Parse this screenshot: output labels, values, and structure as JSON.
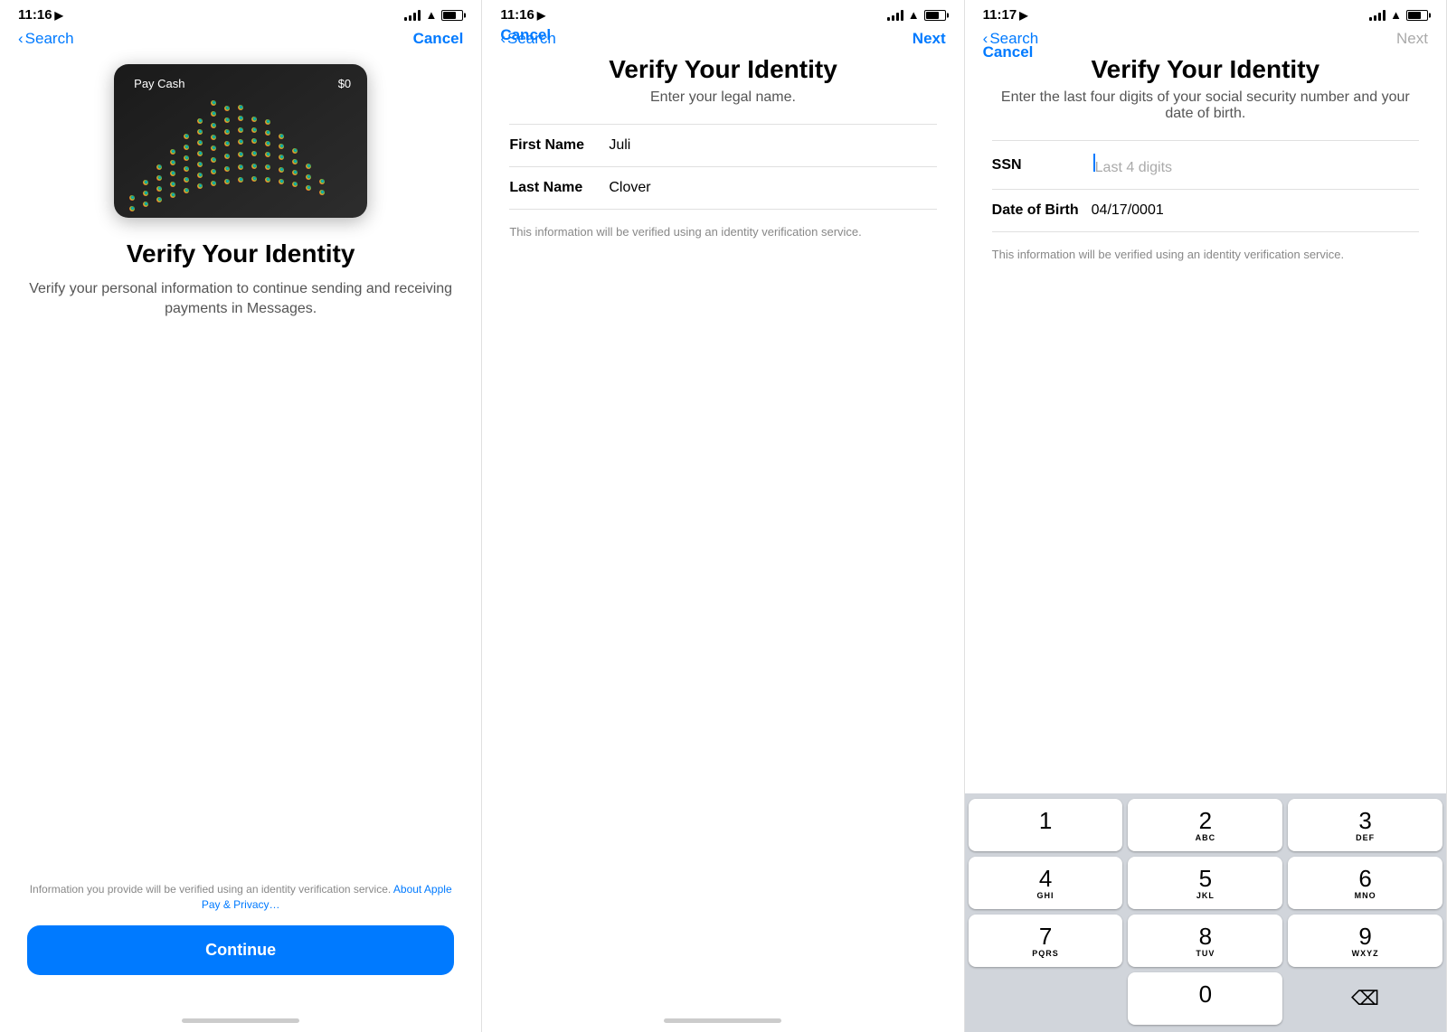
{
  "screens": [
    {
      "id": "screen1",
      "status": {
        "time": "11:16",
        "hasLocation": true
      },
      "nav": {
        "back_label": "Search",
        "cancel_label": "Cancel"
      },
      "card": {
        "brand": "Pay Cash",
        "balance": "$0"
      },
      "title": "Verify Your Identity",
      "subtitle": "Verify your personal information to continue sending and receiving payments in Messages.",
      "footer": {
        "privacy_text": "Information you provide will be verified using an identity verification service.",
        "privacy_link": "About Apple Pay & Privacy…",
        "continue_label": "Continue"
      }
    },
    {
      "id": "screen2",
      "status": {
        "time": "11:16",
        "hasLocation": true
      },
      "nav": {
        "back_label": "Search",
        "cancel_label": "Cancel",
        "next_label": "Next",
        "next_active": true
      },
      "title": "Verify Your Identity",
      "subtitle": "Enter your legal name.",
      "form": {
        "first_name_label": "First Name",
        "first_name_value": "Juli",
        "last_name_label": "Last Name",
        "last_name_value": "Clover",
        "note": "This information will be verified using an identity verification service."
      }
    },
    {
      "id": "screen3",
      "status": {
        "time": "11:17",
        "hasLocation": true
      },
      "nav": {
        "back_label": "Search",
        "cancel_label": "Cancel",
        "next_label": "Next",
        "next_active": false
      },
      "title": "Verify Your Identity",
      "subtitle": "Enter the last four digits of your social security number and your date of birth.",
      "form": {
        "ssn_label": "SSN",
        "ssn_placeholder": "Last 4 digits",
        "dob_label": "Date of Birth",
        "dob_value": "04/17/0001",
        "note": "This information will be verified using an identity verification service."
      },
      "keypad": {
        "keys": [
          {
            "number": "1",
            "letters": ""
          },
          {
            "number": "2",
            "letters": "ABC"
          },
          {
            "number": "3",
            "letters": "DEF"
          },
          {
            "number": "4",
            "letters": "GHI"
          },
          {
            "number": "5",
            "letters": "JKL"
          },
          {
            "number": "6",
            "letters": "MNO"
          },
          {
            "number": "7",
            "letters": "PQRS"
          },
          {
            "number": "8",
            "letters": "TUV"
          },
          {
            "number": "9",
            "letters": "WXYZ"
          },
          {
            "number": "0",
            "letters": ""
          }
        ]
      }
    }
  ]
}
